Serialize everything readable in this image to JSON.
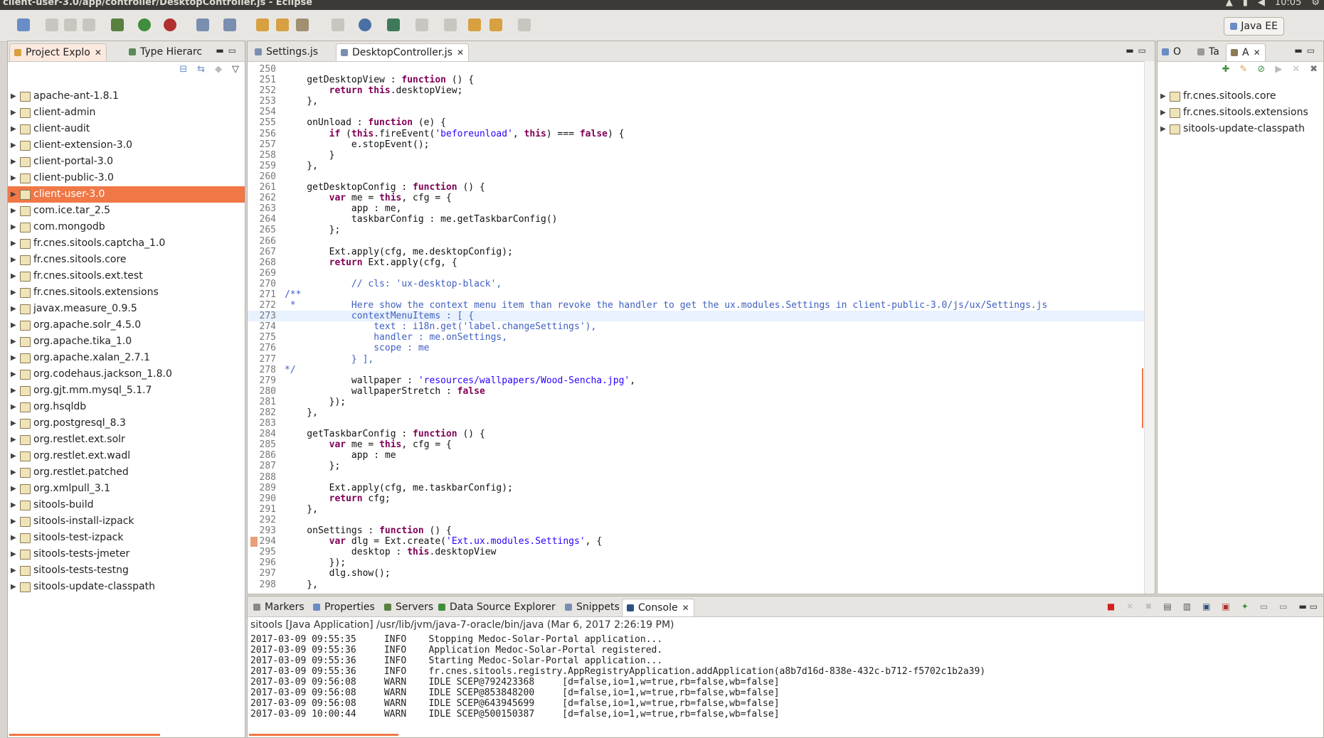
{
  "titlebar": {
    "title": "client-user-3.0/app/controller/DesktopController.js - Eclipse",
    "clock": "10:05"
  },
  "toolbar": {
    "perspective_label": "Java EE"
  },
  "explorer": {
    "tabs": [
      {
        "label": "Project Explo",
        "active": true
      },
      {
        "label": "Type Hierarc",
        "active": false
      }
    ],
    "items": [
      {
        "label": "apache-ant-1.8.1"
      },
      {
        "label": "client-admin"
      },
      {
        "label": "client-audit"
      },
      {
        "label": "client-extension-3.0"
      },
      {
        "label": "client-portal-3.0"
      },
      {
        "label": "client-public-3.0"
      },
      {
        "label": "client-user-3.0",
        "selected": true
      },
      {
        "label": "com.ice.tar_2.5"
      },
      {
        "label": "com.mongodb"
      },
      {
        "label": "fr.cnes.sitools.captcha_1.0"
      },
      {
        "label": "fr.cnes.sitools.core"
      },
      {
        "label": "fr.cnes.sitools.ext.test"
      },
      {
        "label": "fr.cnes.sitools.extensions"
      },
      {
        "label": "javax.measure_0.9.5"
      },
      {
        "label": "org.apache.solr_4.5.0"
      },
      {
        "label": "org.apache.tika_1.0"
      },
      {
        "label": "org.apache.xalan_2.7.1"
      },
      {
        "label": "org.codehaus.jackson_1.8.0"
      },
      {
        "label": "org.gjt.mm.mysql_5.1.7"
      },
      {
        "label": "org.hsqldb"
      },
      {
        "label": "org.postgresql_8.3"
      },
      {
        "label": "org.restlet.ext.solr"
      },
      {
        "label": "org.restlet.ext.wadl"
      },
      {
        "label": "org.restlet.patched"
      },
      {
        "label": "org.xmlpull_3.1"
      },
      {
        "label": "sitools-build"
      },
      {
        "label": "sitools-install-izpack"
      },
      {
        "label": "sitools-test-izpack"
      },
      {
        "label": "sitools-tests-jmeter"
      },
      {
        "label": "sitools-tests-testng"
      },
      {
        "label": "sitools-update-classpath"
      }
    ]
  },
  "editor": {
    "tabs": [
      {
        "label": "Settings.js",
        "active": false
      },
      {
        "label": "DesktopController.js",
        "active": true
      }
    ],
    "lines": [
      {
        "n": "250",
        "t": ""
      },
      {
        "n": "251",
        "t": "    getDesktopView : function () {"
      },
      {
        "n": "252",
        "t": "        return this.desktopView;"
      },
      {
        "n": "253",
        "t": "    },"
      },
      {
        "n": "254",
        "t": ""
      },
      {
        "n": "255",
        "t": "    onUnload : function (e) {"
      },
      {
        "n": "256",
        "t": "        if (this.fireEvent('beforeunload', this) === false) {"
      },
      {
        "n": "257",
        "t": "            e.stopEvent();"
      },
      {
        "n": "258",
        "t": "        }"
      },
      {
        "n": "259",
        "t": "    },"
      },
      {
        "n": "260",
        "t": ""
      },
      {
        "n": "261",
        "t": "    getDesktopConfig : function () {"
      },
      {
        "n": "262",
        "t": "        var me = this, cfg = {"
      },
      {
        "n": "263",
        "t": "            app : me,"
      },
      {
        "n": "264",
        "t": "            taskbarConfig : me.getTaskbarConfig()"
      },
      {
        "n": "265",
        "t": "        };"
      },
      {
        "n": "266",
        "t": ""
      },
      {
        "n": "267",
        "t": "        Ext.apply(cfg, me.desktopConfig);"
      },
      {
        "n": "268",
        "t": "        return Ext.apply(cfg, {"
      },
      {
        "n": "269",
        "t": ""
      },
      {
        "n": "270",
        "t": "            // cls: 'ux-desktop-black',"
      },
      {
        "n": "271",
        "t": "/**"
      },
      {
        "n": "272",
        "t": " *          Here show the context menu item than revoke the handler to get the ux.modules.Settings in client-public-3.0/js/ux/Settings.js"
      },
      {
        "n": "273",
        "t": "            contextMenuItems : [ {",
        "cur": true
      },
      {
        "n": "274",
        "t": "                text : i18n.get('label.changeSettings'),"
      },
      {
        "n": "275",
        "t": "                handler : me.onSettings,"
      },
      {
        "n": "276",
        "t": "                scope : me"
      },
      {
        "n": "277",
        "t": "            } ],"
      },
      {
        "n": "278",
        "t": "*/"
      },
      {
        "n": "279",
        "t": "            wallpaper : 'resources/wallpapers/Wood-Sencha.jpg',"
      },
      {
        "n": "280",
        "t": "            wallpaperStretch : false"
      },
      {
        "n": "281",
        "t": "        });"
      },
      {
        "n": "282",
        "t": "    },"
      },
      {
        "n": "283",
        "t": ""
      },
      {
        "n": "284",
        "t": "    getTaskbarConfig : function () {"
      },
      {
        "n": "285",
        "t": "        var me = this, cfg = {"
      },
      {
        "n": "286",
        "t": "            app : me"
      },
      {
        "n": "287",
        "t": "        };"
      },
      {
        "n": "288",
        "t": ""
      },
      {
        "n": "289",
        "t": "        Ext.apply(cfg, me.taskbarConfig);"
      },
      {
        "n": "290",
        "t": "        return cfg;"
      },
      {
        "n": "291",
        "t": "    },"
      },
      {
        "n": "292",
        "t": ""
      },
      {
        "n": "293",
        "t": "    onSettings : function () {"
      },
      {
        "n": "294",
        "t": "        var dlg = Ext.create('Ext.ux.modules.Settings', {"
      },
      {
        "n": "295",
        "t": "            desktop : this.desktopView"
      },
      {
        "n": "296",
        "t": "        });"
      },
      {
        "n": "297",
        "t": "        dlg.show();"
      },
      {
        "n": "298",
        "t": "    },"
      }
    ]
  },
  "outline": {
    "tabs": [
      {
        "label": "O"
      },
      {
        "label": "Ta"
      },
      {
        "label": "A",
        "active": true
      }
    ],
    "items": [
      {
        "label": "fr.cnes.sitools.core"
      },
      {
        "label": "fr.cnes.sitools.extensions"
      },
      {
        "label": "sitools-update-classpath"
      }
    ]
  },
  "console": {
    "tabs": [
      {
        "label": "Markers"
      },
      {
        "label": "Properties"
      },
      {
        "label": "Servers"
      },
      {
        "label": "Data Source Explorer"
      },
      {
        "label": "Snippets"
      },
      {
        "label": "Console",
        "active": true
      }
    ],
    "header": "sitools [Java Application] /usr/lib/jvm/java-7-oracle/bin/java (Mar 6, 2017 2:26:19 PM)",
    "lines": [
      "2017-03-09 09:55:35     INFO    Stopping Medoc-Solar-Portal application...",
      "2017-03-09 09:55:36     INFO    Application Medoc-Solar-Portal registered.",
      "2017-03-09 09:55:36     INFO    Starting Medoc-Solar-Portal application...",
      "2017-03-09 09:55:36     INFO    fr.cnes.sitools.registry.AppRegistryApplication.addApplication(a8b7d16d-838e-432c-b712-f5702c1b2a39)",
      "2017-03-09 09:56:08     WARN    IDLE SCEP@792423368     [d=false,io=1,w=true,rb=false,wb=false]",
      "2017-03-09 09:56:08     WARN    IDLE SCEP@853848200     [d=false,io=1,w=true,rb=false,wb=false]",
      "2017-03-09 09:56:08     WARN    IDLE SCEP@643945699     [d=false,io=1,w=true,rb=false,wb=false]",
      "2017-03-09 10:00:44     WARN    IDLE SCEP@500150387     [d=false,io=1,w=true,rb=false,wb=false]"
    ]
  },
  "colors": {
    "selection": "#f07746",
    "keyword": "#7f0055",
    "string": "#2a00ff",
    "comment": "#3f5fbf",
    "current_line": "#e8f2fe"
  }
}
